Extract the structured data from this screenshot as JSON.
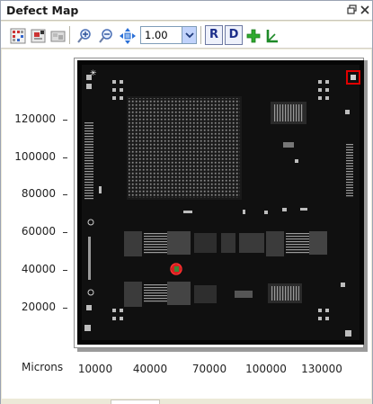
{
  "panel": {
    "title": "Defect Map",
    "restore_icon": "restore-window-icon",
    "close_icon": "close-icon"
  },
  "toolbar": {
    "tools": [
      {
        "name": "defect-class-icon"
      },
      {
        "name": "defect-filter-icon"
      },
      {
        "name": "overlay-icon"
      },
      {
        "name": "zoom-in-icon"
      },
      {
        "name": "zoom-out-icon"
      },
      {
        "name": "pan-icon"
      }
    ],
    "zoom": {
      "value": "1.00"
    },
    "r_label": "R",
    "d_label": "D",
    "add_icon": "add-icon",
    "measure_icon": "measure-icon"
  },
  "map": {
    "y_labels": [
      "120000",
      "100000",
      "80000",
      "60000",
      "40000",
      "20000"
    ],
    "x_labels": [
      "10000",
      "40000",
      "70000",
      "100000",
      "130000"
    ],
    "units_label": "Microns"
  },
  "colors": {
    "accent": "#1c2e8a",
    "highlight": "#e00000",
    "wafer": "#070707"
  }
}
